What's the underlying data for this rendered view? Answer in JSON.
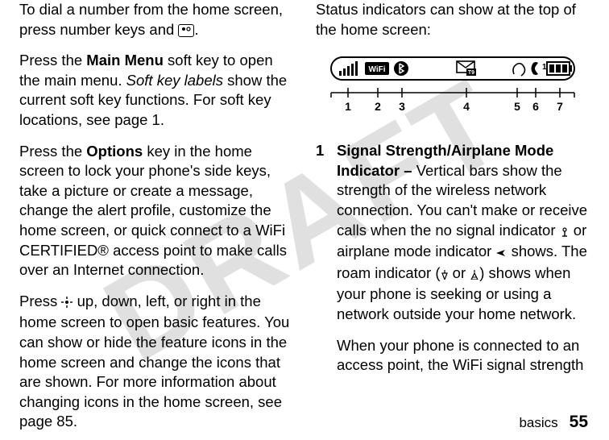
{
  "watermark": "DRAFT",
  "left": {
    "p1_a": "To dial a number from the home screen, press number keys and ",
    "p1_b": ".",
    "p2_a": "Press the ",
    "p2_mainmenu": "Main Menu",
    "p2_b": " soft key to open the main menu. ",
    "p2_softkeylabels": "Soft key labels",
    "p2_c": " show the current soft key functions. For soft key locations, see page 1.",
    "p3_a": "Press the ",
    "p3_options": "Options",
    "p3_b": " key in the home screen to lock your phone's side keys, take a picture or create a message, change the alert profile, customize the home screen, or quick connect to a WiFi CERTIFIED® access point to make calls over an Internet connection.",
    "p4_a": "Press ",
    "p4_b": " up, down, left, or right in the home screen to open basic features. You can show or hide the feature icons in the home screen and change the icons that are shown. For more information about changing icons in the home screen, see page 85."
  },
  "right": {
    "intro": "Status indicators can show at the top of the home screen:",
    "ticks": [
      "1",
      "2",
      "3",
      "4",
      "5",
      "6",
      "7"
    ],
    "item1_num": "1",
    "item1_title": "Signal Strength/Airplane Mode Indicator –",
    "item1_body_a": " Vertical bars show the strength of the wireless network connection. You can't make or receive calls when the no signal indicator ",
    "item1_body_b": " or airplane mode indicator ",
    "item1_body_c": " shows. The roam indicator (",
    "item1_body_or": " or ",
    "item1_body_d": ") shows when your phone is seeking or using a network outside your home network.",
    "item1_p2": "When your phone is connected to an access point, the WiFi signal strength"
  },
  "footer": {
    "label": "basics",
    "page": "55"
  },
  "icons": {
    "call_key": "call-key-icon",
    "nav_key": "nav-key-icon",
    "no_signal": "no-signal-icon",
    "airplane": "airplane-icon",
    "roam1": "roam-indicator-1-icon",
    "roam2": "roam-indicator-2-icon"
  }
}
